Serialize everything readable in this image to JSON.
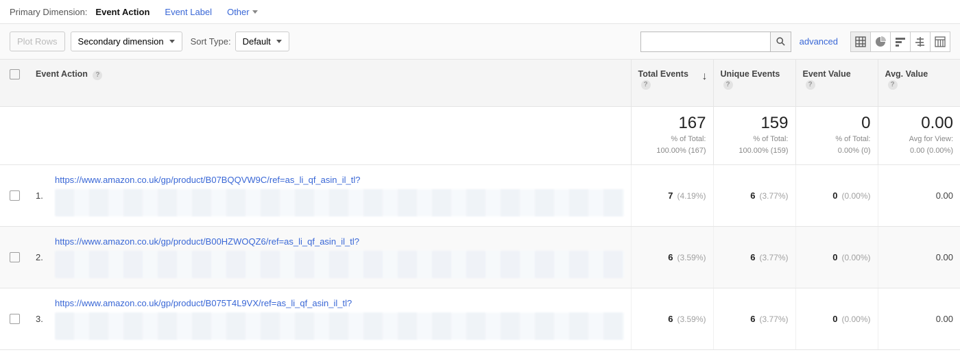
{
  "primaryDimension": {
    "label": "Primary Dimension:",
    "active": "Event Action",
    "options": [
      "Event Label",
      "Other"
    ]
  },
  "controls": {
    "plotRows": "Plot Rows",
    "secondaryDimension": "Secondary dimension",
    "sortTypeLabel": "Sort Type:",
    "sortTypeValue": "Default",
    "advanced": "advanced"
  },
  "columns": {
    "action": "Event Action",
    "totalEvents": "Total Events",
    "uniqueEvents": "Unique Events",
    "eventValue": "Event Value",
    "avgValue": "Avg. Value"
  },
  "summary": {
    "totalEvents": {
      "value": "167",
      "sub1": "% of Total:",
      "sub2": "100.00% (167)"
    },
    "uniqueEvents": {
      "value": "159",
      "sub1": "% of Total:",
      "sub2": "100.00% (159)"
    },
    "eventValue": {
      "value": "0",
      "sub1": "% of Total:",
      "sub2": "0.00% (0)"
    },
    "avgValue": {
      "value": "0.00",
      "sub1": "Avg for View:",
      "sub2": "0.00 (0.00%)"
    }
  },
  "rows": [
    {
      "idx": "1.",
      "url": "https://www.amazon.co.uk/gp/product/B07BQQVW9C/ref=as_li_qf_asin_il_tl?",
      "totalEvents": {
        "v": "7",
        "p": "(4.19%)"
      },
      "uniqueEvents": {
        "v": "6",
        "p": "(3.77%)"
      },
      "eventValue": {
        "v": "0",
        "p": "(0.00%)"
      },
      "avgValue": "0.00"
    },
    {
      "idx": "2.",
      "url": "https://www.amazon.co.uk/gp/product/B00HZWOQZ6/ref=as_li_qf_asin_il_tl?",
      "totalEvents": {
        "v": "6",
        "p": "(3.59%)"
      },
      "uniqueEvents": {
        "v": "6",
        "p": "(3.77%)"
      },
      "eventValue": {
        "v": "0",
        "p": "(0.00%)"
      },
      "avgValue": "0.00"
    },
    {
      "idx": "3.",
      "url": "https://www.amazon.co.uk/gp/product/B075T4L9VX/ref=as_li_qf_asin_il_tl?",
      "totalEvents": {
        "v": "6",
        "p": "(3.59%)"
      },
      "uniqueEvents": {
        "v": "6",
        "p": "(3.77%)"
      },
      "eventValue": {
        "v": "0",
        "p": "(0.00%)"
      },
      "avgValue": "0.00"
    }
  ]
}
